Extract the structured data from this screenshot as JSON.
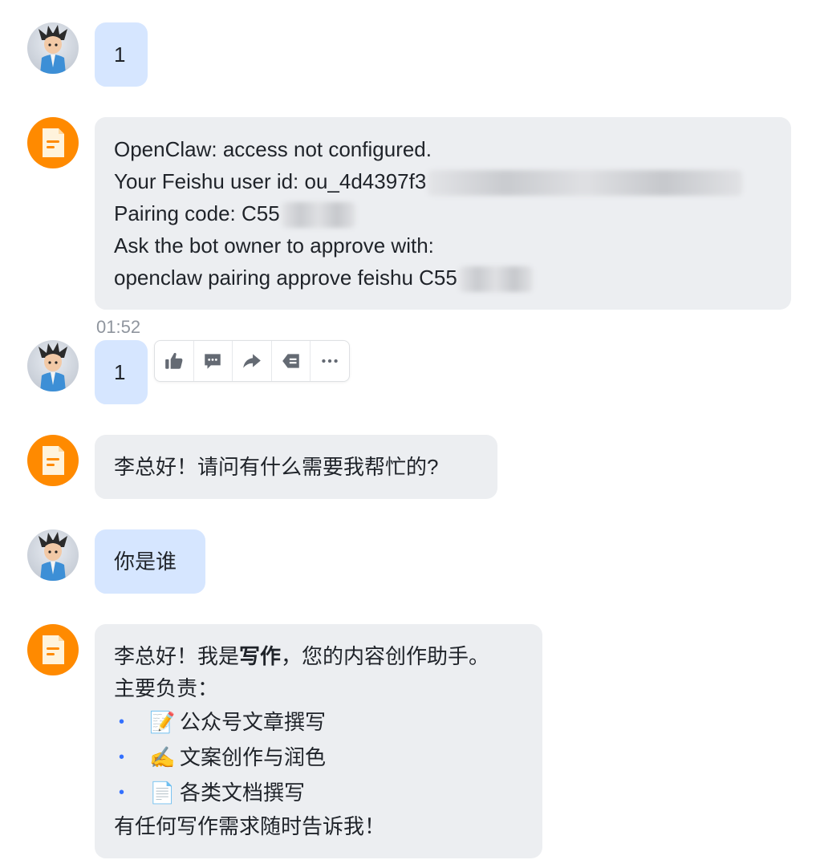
{
  "messages": {
    "m1": {
      "text": "1"
    },
    "m2": {
      "line1": "OpenClaw: access not configured.",
      "line2": "Your Feishu user id: ou_4d4397f3",
      "line3": "Pairing code: C55",
      "line4": "Ask the bot owner to approve with:",
      "line5": "openclaw pairing approve feishu C55"
    },
    "timestamp": "01:52",
    "m3": {
      "text": "1"
    },
    "m4": {
      "text": "李总好！请问有什么需要我帮忙的?"
    },
    "m5": {
      "text": "你是谁"
    },
    "m6": {
      "intro_pre": "李总好！我是",
      "intro_bold": "写作",
      "intro_post": "，您的内容创作助手。",
      "heading": "主要负责：",
      "items": [
        {
          "emoji": "📝",
          "text": "公众号文章撰写"
        },
        {
          "emoji": "✍️",
          "text": "文案创作与润色"
        },
        {
          "emoji": "📄",
          "text": "各类文档撰写"
        }
      ],
      "outro": "有任何写作需求随时告诉我！"
    }
  },
  "toolbar": {
    "icons": [
      "thumbs-up-icon",
      "comment-icon",
      "forward-icon",
      "quote-reply-icon",
      "more-icon"
    ]
  },
  "colors": {
    "user_bubble": "#d6e6ff",
    "bot_bubble": "#eceef1",
    "bot_avatar": "#ff8a00",
    "bullet": "#3370ff"
  }
}
